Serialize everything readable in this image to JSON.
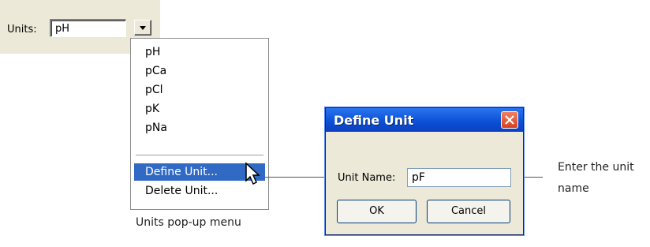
{
  "units": {
    "label": "Units:",
    "value": "pH"
  },
  "menu": {
    "items": [
      "pH",
      "pCa",
      "pCl",
      "pK",
      "pNa"
    ],
    "define_label": "Define Unit...",
    "delete_label": "Delete Unit...",
    "selected": "Define Unit..."
  },
  "popup_caption": "Units pop-up menu",
  "dialog": {
    "title": "Define Unit",
    "field_label": "Unit Name:",
    "field_value": "pF",
    "ok_label": "OK",
    "cancel_label": "Cancel"
  },
  "right_caption": {
    "line1": "Enter the unit",
    "line2": "name"
  },
  "colors": {
    "selection": "#316ac5",
    "titlebar": "#0a4fd4",
    "face": "#ece9d8"
  }
}
